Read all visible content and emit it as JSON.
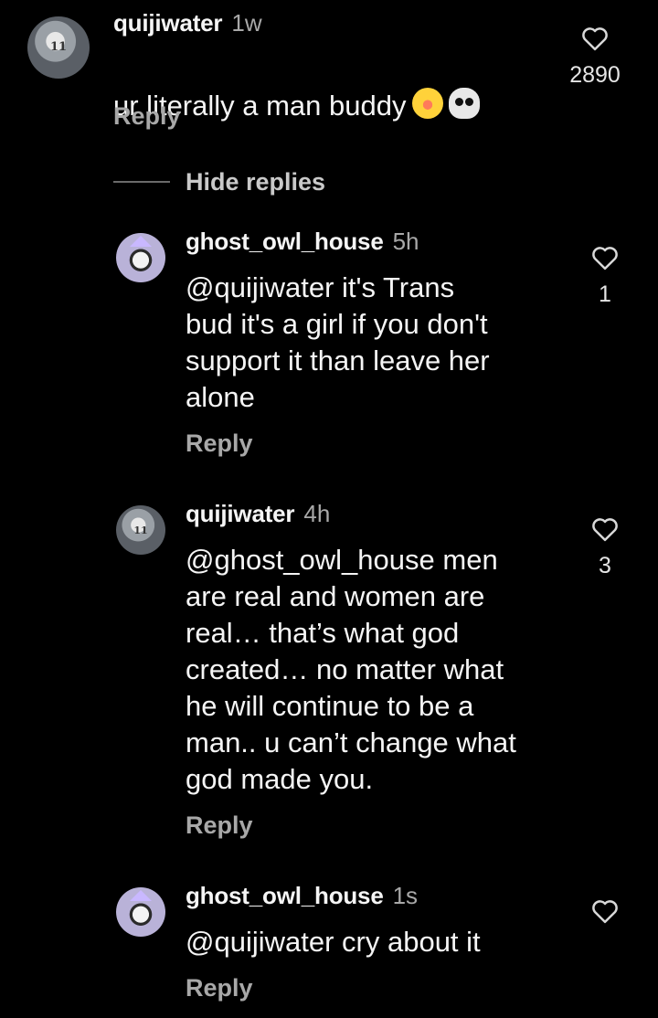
{
  "comment": {
    "username": "quijiwater",
    "time": "1w",
    "text": "ur literally a man buddy",
    "emojis": [
      "face-with-tears-of-joy",
      "skull"
    ],
    "reply_label": "Reply",
    "likes": "2890"
  },
  "hide_replies_label": "Hide replies",
  "replies": [
    {
      "username": "ghost_owl_house",
      "time": "5h",
      "text": "@quijiwater it's Trans\nbud it's a girl if you don't\nsupport it than leave her\nalone",
      "reply_label": "Reply",
      "likes": "1"
    },
    {
      "username": "quijiwater",
      "time": "4h",
      "text": "@ghost_owl_house men\nare real and women are\nreal… that’s what god\ncreated… no matter what\nhe will continue to be a\nman.. u can’t change what\ngod made you.",
      "reply_label": "Reply",
      "likes": "3"
    },
    {
      "username": "ghost_owl_house",
      "time": "1s",
      "text": "@quijiwater cry about it",
      "reply_label": "Reply",
      "likes": ""
    }
  ],
  "avatar_jersey_number": "11",
  "colors": {
    "background": "#000000",
    "secondary_text": "#a8a8a8",
    "primary_text": "#f5f5f5"
  }
}
